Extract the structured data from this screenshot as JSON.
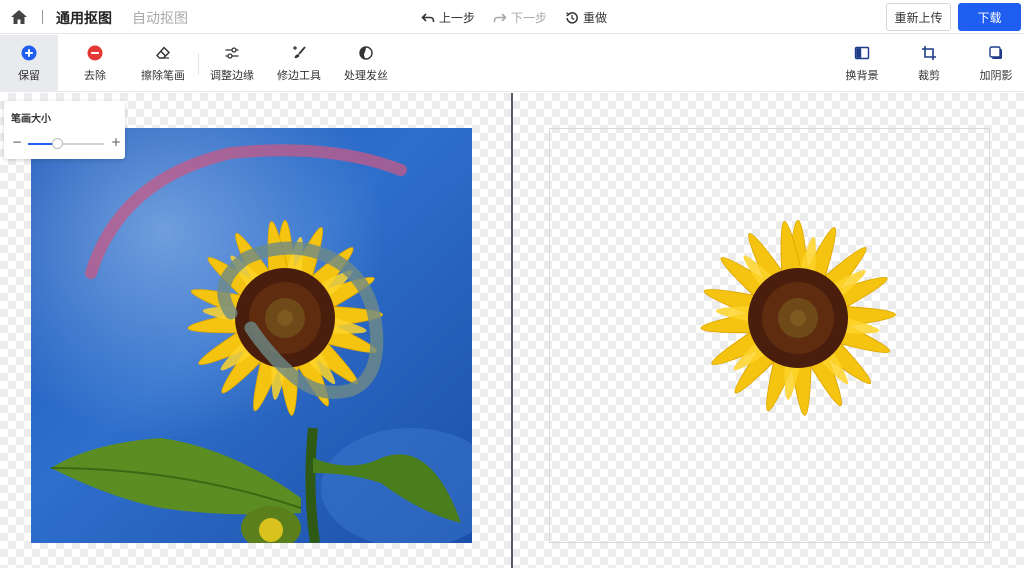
{
  "header": {
    "home_icon": "home-icon",
    "tabs": [
      {
        "label": "通用抠图",
        "active": true
      },
      {
        "label": "自动抠图",
        "active": false
      }
    ],
    "history": {
      "undo": {
        "label": "上一步",
        "icon": "undo-icon",
        "enabled": true
      },
      "redo": {
        "label": "下一步",
        "icon": "redo-icon",
        "enabled": false
      },
      "reset": {
        "label": "重做",
        "icon": "history-icon"
      }
    },
    "reupload_label": "重新上传",
    "download_label": "下载"
  },
  "toolbar": {
    "left_tools": [
      {
        "label": "保留",
        "icon": "plus-circle-icon",
        "selected": true
      },
      {
        "label": "去除",
        "icon": "minus-circle-icon",
        "selected": false
      },
      {
        "label": "擦除笔画",
        "icon": "eraser-icon",
        "selected": false
      },
      {
        "label": "调整边缘",
        "icon": "sliders-icon",
        "selected": false
      },
      {
        "label": "修边工具",
        "icon": "brush-icon",
        "selected": false
      },
      {
        "label": "处理发丝",
        "icon": "hair-icon",
        "selected": false
      }
    ],
    "right_tools": [
      {
        "label": "换背景",
        "icon": "background-icon"
      },
      {
        "label": "裁剪",
        "icon": "crop-icon"
      },
      {
        "label": "加阴影",
        "icon": "shadow-icon"
      }
    ]
  },
  "brush": {
    "title": "笔画大小",
    "minus": "−",
    "plus": "+",
    "level": 0.38
  },
  "colors": {
    "accent": "#1f5ef0",
    "keep": "#1f5ef0",
    "remove": "#e53935",
    "keep_stroke": "#6e8a86",
    "remove_stroke": "#c65a86",
    "divider": "#555a66"
  }
}
